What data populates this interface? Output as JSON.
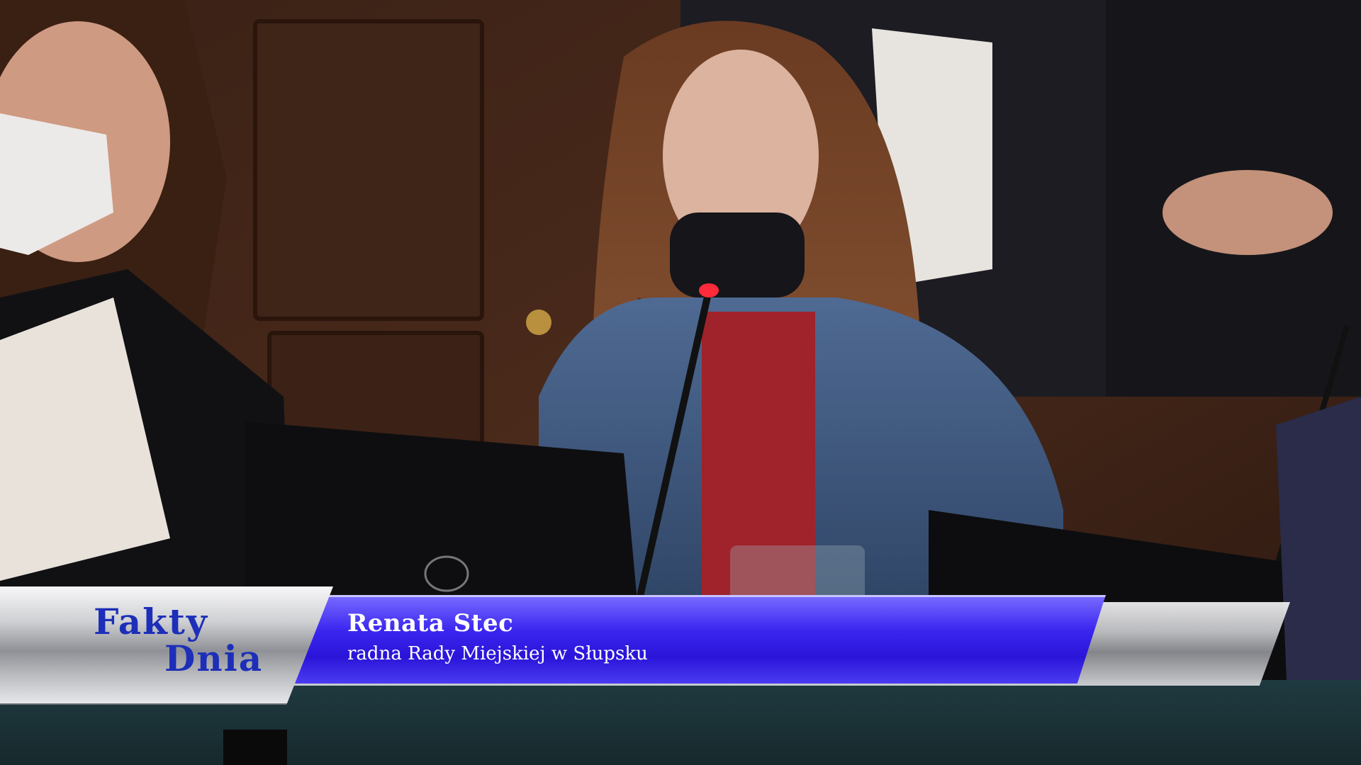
{
  "channel": {
    "logo_line1": "Fakty",
    "logo_line2": "Dnia"
  },
  "caption": {
    "name": "Renata Stec",
    "title": "radna Rady Miejskiej w Słupsku"
  },
  "colors": {
    "name_bar": "#2a14d8",
    "logo_text": "#1d2fb8",
    "silver": "#c9cacd"
  }
}
